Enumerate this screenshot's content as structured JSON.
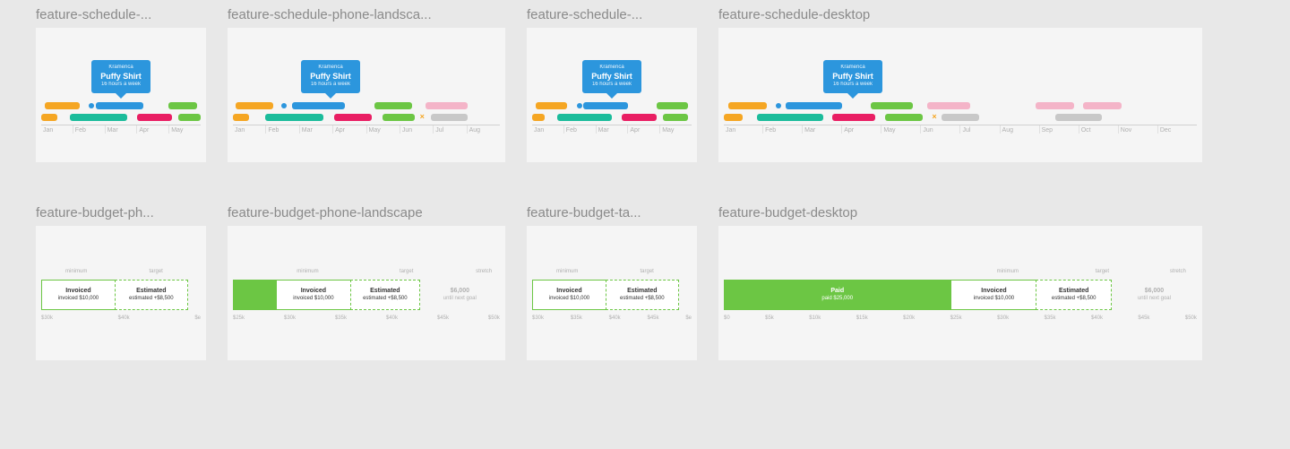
{
  "tooltip": {
    "client": "Kramerica",
    "project": "Puffy Shirt",
    "hours": "16 hours a week"
  },
  "months12": [
    "Jan",
    "Feb",
    "Mar",
    "Apr",
    "May",
    "Jun",
    "Jul",
    "Aug",
    "Sep",
    "Oct",
    "Nov",
    "Dec"
  ],
  "months7": [
    "Jan",
    "Feb",
    "Mar",
    "Apr",
    "May",
    "Jun",
    "Jul",
    "Aug"
  ],
  "months5": [
    "Jan",
    "Feb",
    "Mar",
    "Apr",
    "May"
  ],
  "budget": {
    "markers": {
      "minimum": "minimum",
      "target": "target",
      "stretch": "stretch"
    },
    "paid": {
      "label": "Paid",
      "sub": "paid $25,000"
    },
    "inv": {
      "label": "Invoiced",
      "sub": "invoiced $10,000"
    },
    "est": {
      "label": "Estimated",
      "sub": "estimated +$8,500"
    },
    "next": {
      "label": "$6,000",
      "sub": "until next goal"
    },
    "axis_full": [
      "$0",
      "$5k",
      "$10k",
      "$15k",
      "$20k",
      "$25k",
      "$30k",
      "$35k",
      "$40k",
      "$45k",
      "$50k"
    ],
    "axis_med": [
      "$25k",
      "$30k",
      "$35k",
      "$40k",
      "$45k",
      "$50k"
    ],
    "axis_short": [
      "$30k",
      "$35k",
      "$40k",
      "$45k",
      "$e"
    ],
    "axis_phone": [
      "$30k",
      "$40k",
      "$e"
    ]
  },
  "thumbs": {
    "s_phone": {
      "title": "feature-schedule-..."
    },
    "s_land": {
      "title": "feature-schedule-phone-landsca..."
    },
    "s_tab": {
      "title": "feature-schedule-..."
    },
    "s_desk": {
      "title": "feature-schedule-desktop"
    },
    "b_phone": {
      "title": "feature-budget-ph..."
    },
    "b_land": {
      "title": "feature-budget-phone-landscape"
    },
    "b_tab": {
      "title": "feature-budget-ta..."
    },
    "b_desk": {
      "title": "feature-budget-desktop"
    }
  }
}
